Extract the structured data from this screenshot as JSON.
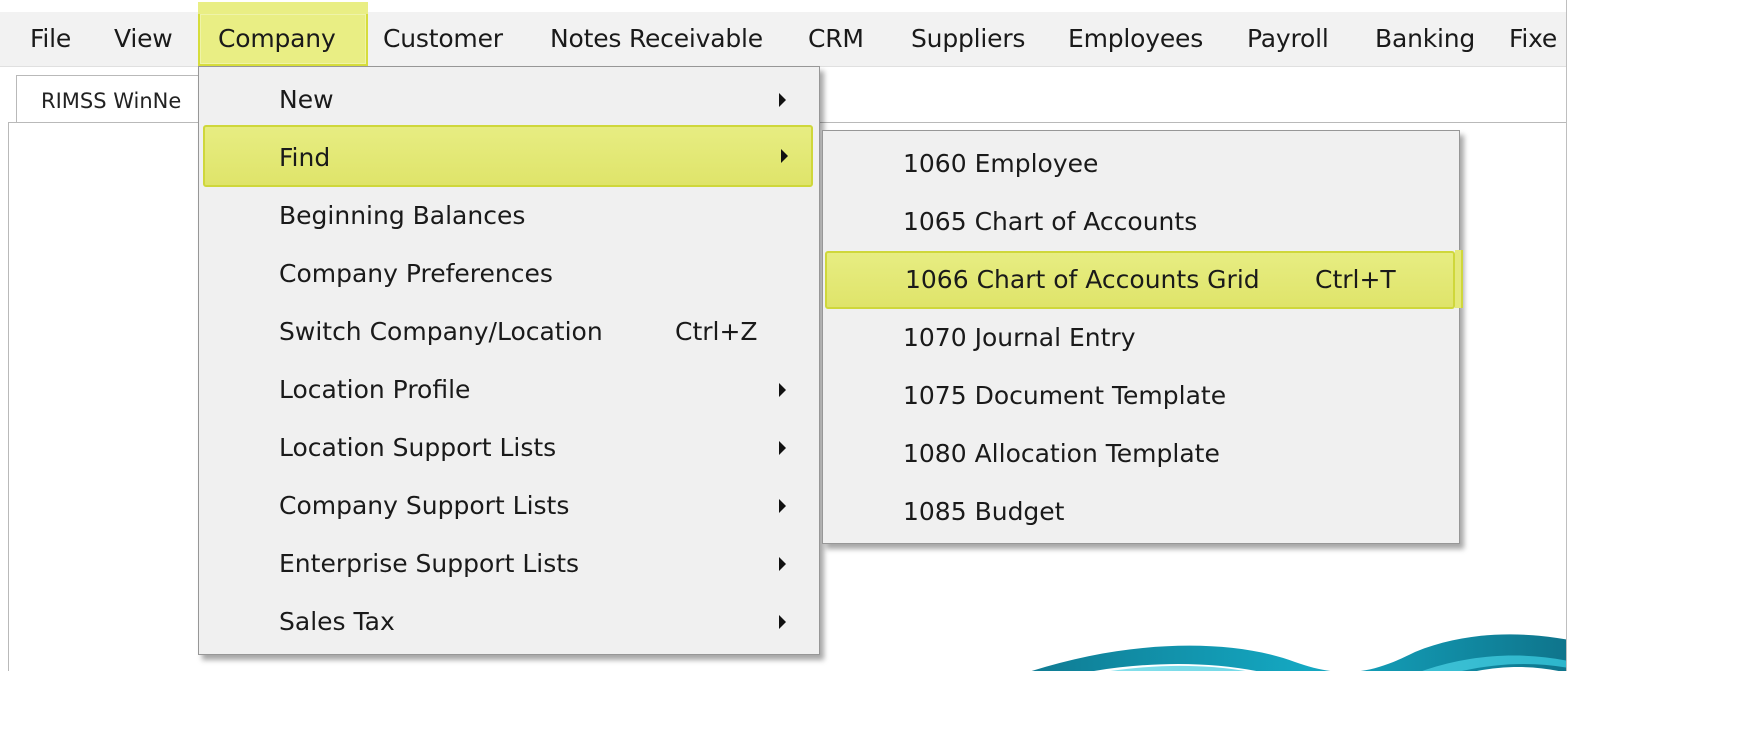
{
  "menubar": {
    "items": [
      {
        "label": "File"
      },
      {
        "label": "View"
      },
      {
        "label": "Company"
      },
      {
        "label": "Customer"
      },
      {
        "label": "Notes Receivable"
      },
      {
        "label": "CRM"
      },
      {
        "label": "Suppliers"
      },
      {
        "label": "Employees"
      },
      {
        "label": "Payroll"
      },
      {
        "label": "Banking"
      },
      {
        "label": "Fixe"
      }
    ]
  },
  "tab": {
    "label": "RIMSS WinNe"
  },
  "company_menu": {
    "items": [
      {
        "label": "New",
        "shortcut": ""
      },
      {
        "label": "Find",
        "shortcut": ""
      },
      {
        "label": "Beginning Balances",
        "shortcut": ""
      },
      {
        "label": "Company Preferences",
        "shortcut": ""
      },
      {
        "label": "Switch Company/Location",
        "shortcut": "Ctrl+Z"
      },
      {
        "label": "Location Profile",
        "shortcut": ""
      },
      {
        "label": "Location Support Lists",
        "shortcut": ""
      },
      {
        "label": "Company Support Lists",
        "shortcut": ""
      },
      {
        "label": "Enterprise Support Lists",
        "shortcut": ""
      },
      {
        "label": "Sales Tax",
        "shortcut": ""
      }
    ]
  },
  "find_submenu": {
    "items": [
      {
        "label": "1060 Employee",
        "shortcut": ""
      },
      {
        "label": "1065 Chart of Accounts",
        "shortcut": ""
      },
      {
        "label": "1066 Chart of Accounts Grid",
        "shortcut": "Ctrl+T"
      },
      {
        "label": "1070 Journal Entry",
        "shortcut": ""
      },
      {
        "label": "1075 Document Template",
        "shortcut": ""
      },
      {
        "label": "1080 Allocation Template",
        "shortcut": ""
      },
      {
        "label": "1085 Budget",
        "shortcut": ""
      }
    ]
  },
  "colors": {
    "highlight": "#e7ed82",
    "highlight_border": "#cfd73b",
    "menu_bg": "#f0f0f0",
    "menubar_bg": "#f2f2f2",
    "swoosh_dark": "#0e6f86",
    "swoosh_light": "#7ee0ec"
  }
}
